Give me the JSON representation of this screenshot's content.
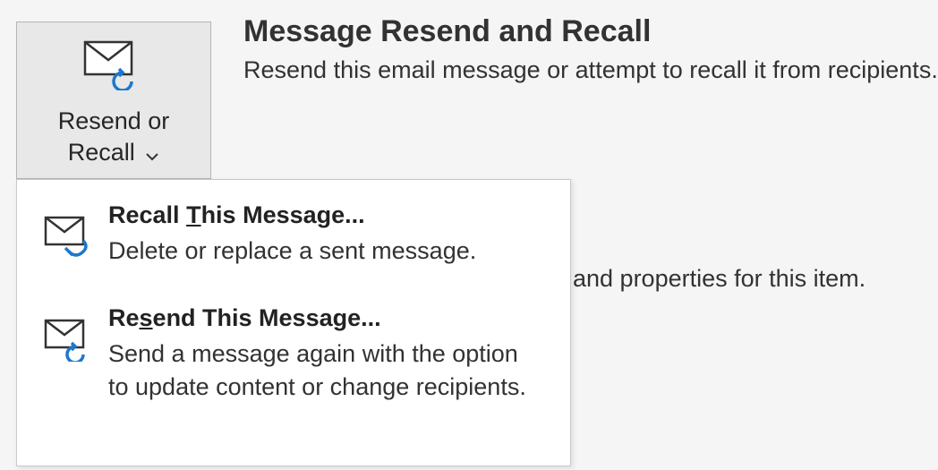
{
  "ribbonButton": {
    "label_line1": "Resend or",
    "label_line2": "Recall"
  },
  "heading": {
    "title": "Message Resend and Recall",
    "subtitle": "Resend this email message or attempt to recall it from recipients."
  },
  "backgroundText": "and properties for this item.",
  "menu": {
    "recall": {
      "title_pre": "Recall ",
      "title_u": "T",
      "title_post": "his Message...",
      "desc": "Delete or replace a sent message."
    },
    "resend": {
      "title_pre": "Re",
      "title_u": "s",
      "title_post": "end This Message...",
      "desc_line1": "Send a message again with the option",
      "desc_line2": "to update content or change recipients."
    }
  }
}
